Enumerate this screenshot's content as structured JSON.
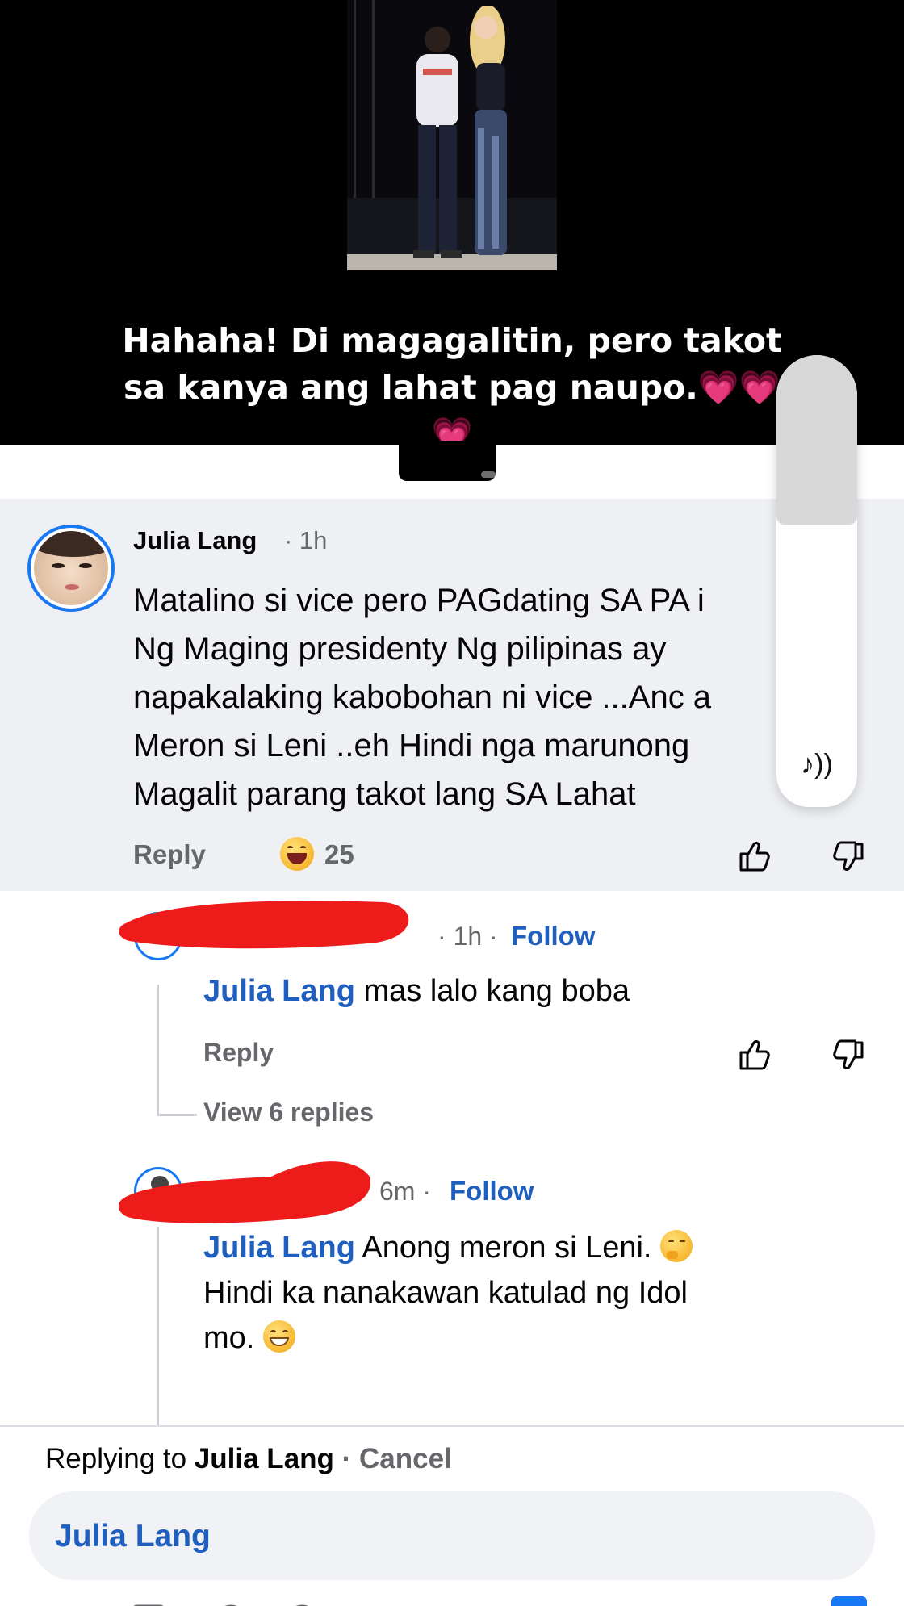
{
  "post": {
    "caption_line1": "Hahaha! Di magagalitin, pero takot",
    "caption_line2": "sa kanya ang lahat pag naupo.💗💗",
    "caption_line3": "💗"
  },
  "comment": {
    "author": "Julia Lang",
    "time": "· 1h",
    "text": "Matalino si vice pero PAGdating SA PA      i\nNg Maging presidenty Ng pilipinas ay\nnapakalaking kabobohan ni vice ...Anc        a\nMeron si Leni ..eh Hindi nga marunong\nMagalit parang takot lang SA Lahat",
    "reply_label": "Reply",
    "reaction_count": "25"
  },
  "overlay": {
    "icon": "♪))"
  },
  "replies": [
    {
      "meta": "· 1h ·",
      "follow": "Follow",
      "mention": "Julia Lang",
      "text": " mas lalo kang boba",
      "reply_label": "Reply",
      "view_replies": "View 6 replies"
    },
    {
      "meta": "6m ·",
      "follow": "Follow",
      "mention": "Julia Lang",
      "text_line1": " Anong meron si Leni. ",
      "text_line2": "Hindi ka nanakawan katulad ng Idol",
      "text_line3": "mo. "
    }
  ],
  "reply_bar": {
    "prefix": "Replying to ",
    "target": "Julia Lang",
    "separator": " · ",
    "cancel": "Cancel",
    "input_value": "Julia Lang"
  },
  "colors": {
    "accent": "#1877f2",
    "mention": "#1e5fbf",
    "redaction": "#ee1b1b"
  }
}
